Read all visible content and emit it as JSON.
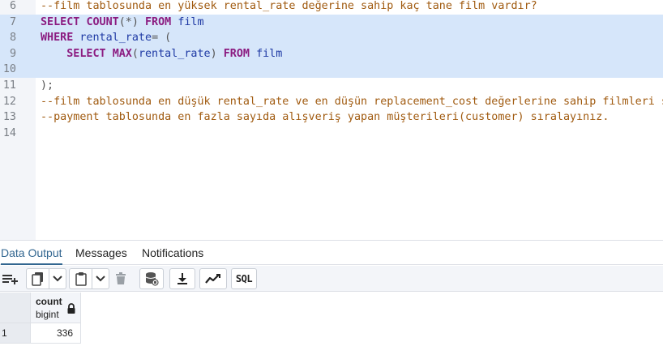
{
  "editor": {
    "lines": [
      {
        "num": "6",
        "segments": [
          {
            "cls": "comment",
            "text": "--film tablosunda en yüksek rental_rate değerine sahip kaç tane film vardır?"
          }
        ],
        "selected": false
      },
      {
        "num": "7",
        "segments": [
          {
            "cls": "kw",
            "text": "SELECT "
          },
          {
            "cls": "fn",
            "text": "COUNT"
          },
          {
            "cls": "punct",
            "text": "(*) "
          },
          {
            "cls": "kw",
            "text": "FROM "
          },
          {
            "cls": "ident",
            "text": "film"
          }
        ],
        "selected": true
      },
      {
        "num": "8",
        "segments": [
          {
            "cls": "kw",
            "text": "WHERE "
          },
          {
            "cls": "ident",
            "text": "rental_rate"
          },
          {
            "cls": "punct",
            "text": "= ("
          }
        ],
        "selected": true
      },
      {
        "num": "9",
        "segments": [
          {
            "cls": "plain",
            "text": "    "
          },
          {
            "cls": "kw",
            "text": "SELECT "
          },
          {
            "cls": "fn",
            "text": "MAX"
          },
          {
            "cls": "punct",
            "text": "("
          },
          {
            "cls": "ident",
            "text": "rental_rate"
          },
          {
            "cls": "punct",
            "text": ") "
          },
          {
            "cls": "kw",
            "text": "FROM "
          },
          {
            "cls": "ident",
            "text": "film"
          }
        ],
        "selected": true
      },
      {
        "num": "10",
        "segments": [],
        "selected": true
      },
      {
        "num": "11",
        "segments": [
          {
            "cls": "punct",
            "text": ");"
          }
        ],
        "selected": "partial"
      },
      {
        "num": "12",
        "segments": [
          {
            "cls": "comment",
            "text": "--film tablosunda en düşük rental_rate ve en düşün replacement_cost değerlerine sahip filmleri sıralayınız."
          }
        ],
        "selected": false
      },
      {
        "num": "13",
        "segments": [
          {
            "cls": "comment",
            "text": "--payment tablosunda en fazla sayıda alışveriş yapan müşterileri(customer) sıralayınız."
          }
        ],
        "selected": false
      },
      {
        "num": "14",
        "segments": [],
        "selected": false
      }
    ]
  },
  "tabs": {
    "data_output": "Data Output",
    "messages": "Messages",
    "notifications": "Notifications"
  },
  "toolbar": {
    "sql_label": "SQL",
    "icons": [
      "add-row-icon",
      "copy-icon",
      "chevron-down-icon",
      "paste-icon",
      "chevron-down-icon",
      "delete-icon",
      "save-data-icon",
      "download-icon",
      "graph-icon",
      "sql-icon"
    ]
  },
  "grid": {
    "columns": [
      {
        "name": "count",
        "type": "bigint",
        "readonly": true
      }
    ],
    "rows": [
      {
        "num": "1",
        "values": [
          "336"
        ]
      }
    ]
  },
  "colors": {
    "selection": "#d6e6fa",
    "keyword": "#8b1b80",
    "identifier": "#1f3aa4",
    "comment": "#a05a0f",
    "active_tab": "#326690"
  }
}
